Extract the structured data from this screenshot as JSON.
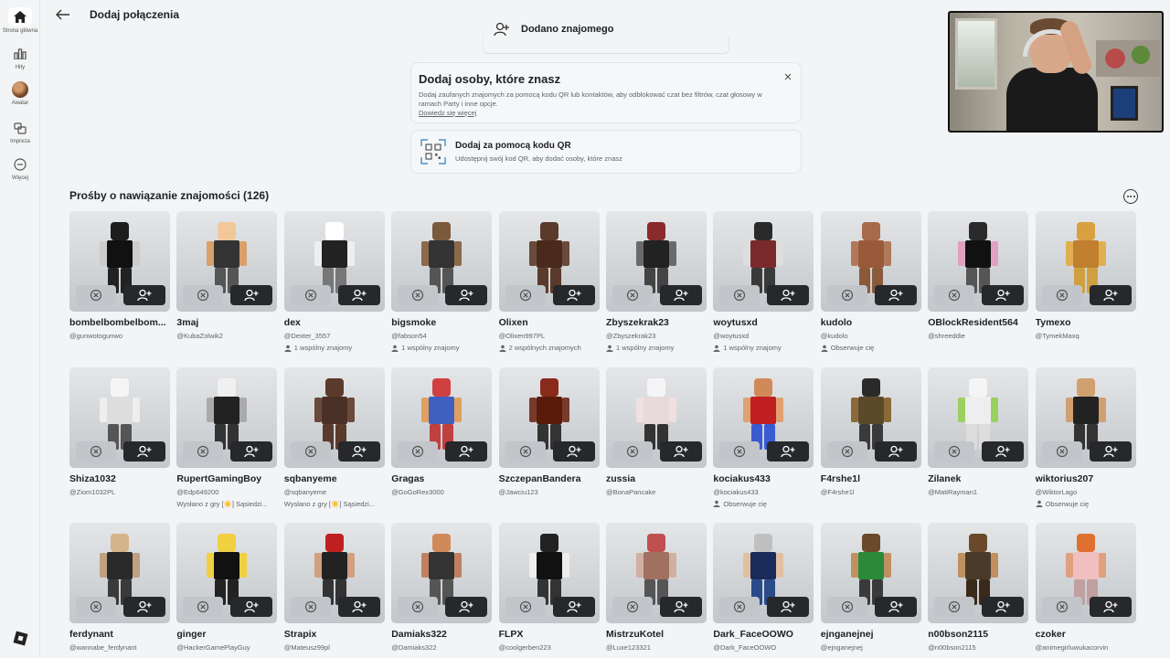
{
  "sidebar": {
    "items": [
      {
        "label": "Strona główna",
        "icon": "home-icon"
      },
      {
        "label": "Hity",
        "icon": "charts-icon"
      },
      {
        "label": "Awatar",
        "icon": "avatar-icon"
      },
      {
        "label": "Impreza",
        "icon": "party-icon"
      },
      {
        "label": "Więcej",
        "icon": "more-icon"
      }
    ]
  },
  "header": {
    "title": "Dodaj połączenia"
  },
  "toast": {
    "text": "Dodano znajomego"
  },
  "add_people": {
    "title": "Dodaj osoby, które znasz",
    "body": "Dodaj zaufanych znajomych za pomocą kodu QR lub kontaktów, aby odblokować czat bez filtrów, czat głosowy w ramach Party i inne opcje.",
    "link": "Dowiedz się więcej"
  },
  "qr": {
    "title": "Dodaj za pomocą kodu QR",
    "subtitle": "Udostępnij swój kod QR, aby dodać osoby, które znasz"
  },
  "requests": {
    "title": "Prośby o nawiązanie znajomości (126)",
    "items": [
      {
        "name": "bombelbombelbom...",
        "handle": "@gunwotogunwo",
        "extra": ""
      },
      {
        "name": "3maj",
        "handle": "@KubaZolwik2",
        "extra": ""
      },
      {
        "name": "dex",
        "handle": "@Dexter_3557",
        "extra": "1 wspólny znajomy"
      },
      {
        "name": "bigsmoke",
        "handle": "@fabson54",
        "extra": "1 wspólny znajomy"
      },
      {
        "name": "Olixen",
        "handle": "@Olixen997PL",
        "extra": "2 wspólnych znajomych"
      },
      {
        "name": "Zbyszekrak23",
        "handle": "@Zbyszekrak23",
        "extra": "1 wspólny znajomy"
      },
      {
        "name": "woytusxd",
        "handle": "@woytusxd",
        "extra": "1 wspólny znajomy"
      },
      {
        "name": "kudolo",
        "handle": "@kudolo",
        "extra": "Obserwuje cię"
      },
      {
        "name": "OBlockResident564",
        "handle": "@shreeddie",
        "extra": ""
      },
      {
        "name": "Tymexo",
        "handle": "@TymekMaxq",
        "extra": ""
      },
      {
        "name": "Shiza1032",
        "handle": "@Ziom1032PL",
        "extra": ""
      },
      {
        "name": "RupertGamingBoy",
        "handle": "@Edp649200",
        "extra": "Wysłano z gry [☀️] Sąsiedzi..."
      },
      {
        "name": "sqbanyeme",
        "handle": "@sqbanyeme",
        "extra": "Wysłano z gry [☀️] Sąsiedzi..."
      },
      {
        "name": "Gragas",
        "handle": "@GoGoRex3000",
        "extra": ""
      },
      {
        "name": "SzczepanBandera",
        "handle": "@Jawciu123",
        "extra": ""
      },
      {
        "name": "zussia",
        "handle": "@BonaPancake",
        "extra": ""
      },
      {
        "name": "kociakus433",
        "handle": "@kociakus433",
        "extra": "Obserwuje cię"
      },
      {
        "name": "F4rshe1l",
        "handle": "@F4rshe1l",
        "extra": ""
      },
      {
        "name": "Zilanek",
        "handle": "@MatiRayman1",
        "extra": ""
      },
      {
        "name": "wiktorius207",
        "handle": "@WiktorLago",
        "extra": "Obserwuje cię"
      },
      {
        "name": "ferdynant",
        "handle": "@wannabe_ferdynant",
        "extra": ""
      },
      {
        "name": "ginger",
        "handle": "@HackerGamePlayGuy",
        "extra": ""
      },
      {
        "name": "Strapix",
        "handle": "@Mateusz99pl",
        "extra": ""
      },
      {
        "name": "Damiaks322",
        "handle": "@Damiaks322",
        "extra": ""
      },
      {
        "name": "FLPX",
        "handle": "@coolgerben223",
        "extra": ""
      },
      {
        "name": "MistrzuKotel",
        "handle": "@Luxe123321",
        "extra": ""
      },
      {
        "name": "Dark_FaceOOWO",
        "handle": "@Dark_FaceOOWO",
        "extra": ""
      },
      {
        "name": "ejnganejnej",
        "handle": "@ejnganejnej",
        "extra": ""
      },
      {
        "name": "n00bson2115",
        "handle": "@n00bson2115",
        "extra": ""
      },
      {
        "name": "czoker",
        "handle": "@animegirluwukacorvin",
        "extra": ""
      }
    ]
  },
  "colors": {
    "background": "#f2f4f5",
    "accept_button": "#26282b",
    "decline_button": "#c2c5c9"
  }
}
